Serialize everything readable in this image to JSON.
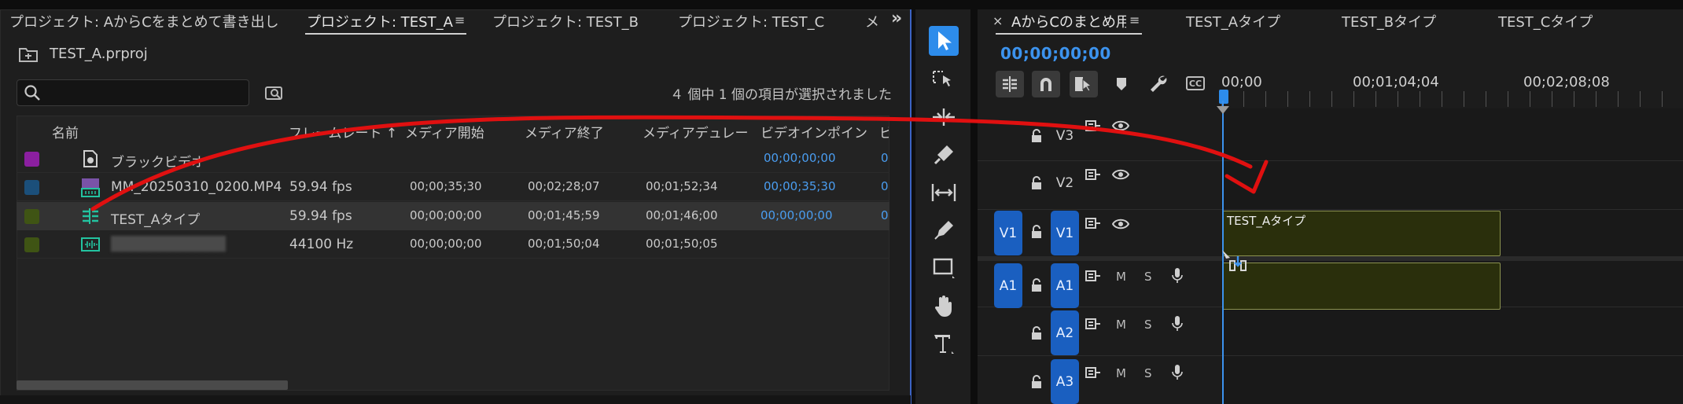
{
  "project_panel": {
    "tabs": [
      {
        "label": "プロジェクト: AからCをまとめて書き出し"
      },
      {
        "label": "プロジェクト: TEST_A"
      },
      {
        "label": "プロジェクト: TEST_B"
      },
      {
        "label": "プロジェクト: TEST_C"
      },
      {
        "label": "メ"
      }
    ],
    "overflow_label": "»",
    "menu_label": "≡",
    "file_name": "TEST_A.prproj",
    "search": {
      "value": "",
      "placeholder": ""
    },
    "selection_status": "４ 個中 1 個の項目が選択されました",
    "columns": [
      "名前",
      "フレームレート ↑",
      "メディア開始",
      "メディア終了",
      "メディアデュレー",
      "ビデオインポイン",
      "ビ"
    ],
    "rows": [
      {
        "swatch": "#8b1fa0",
        "icon": "black-video-icon",
        "name": "ブラックビデオ",
        "fps": "",
        "start": "",
        "end": "",
        "duration": "",
        "in_point": "00;00;00;00",
        "extra": "0"
      },
      {
        "swatch": "#1b4f7a",
        "icon": "video-clip-icon",
        "name": "MM_20250310_0200.MP4",
        "fps": "59.94 fps",
        "start": "00;00;35;30",
        "end": "00;02;28;07",
        "duration": "00;01;52;34",
        "in_point": "00;00;35;30",
        "extra": "0"
      },
      {
        "swatch": "#3f5414",
        "icon": "sequence-icon",
        "name": "TEST_Aタイプ",
        "fps": "59.94 fps",
        "start": "00;00;00;00",
        "end": "00;01;45;59",
        "duration": "00;01;46;00",
        "in_point": "00;00;00;00",
        "extra": "0"
      },
      {
        "swatch": "#3f5414",
        "icon": "audio-clip-icon",
        "name": "████████████",
        "fps": "44100 Hz",
        "start": "00;00;00;00",
        "end": "00;01;50;04",
        "duration": "00;01;50;05",
        "in_point": "",
        "extra": ""
      }
    ]
  },
  "timeline_panel": {
    "close_label": "×",
    "menu_label": "≡",
    "tabs": [
      {
        "label": "AからCのまとめ用"
      },
      {
        "label": "TEST_Aタイプ"
      },
      {
        "label": "TEST_Bタイプ"
      },
      {
        "label": "TEST_Cタイプ"
      }
    ],
    "timecode": "00;00;00;00",
    "ruler": [
      "00;00",
      "00;01;04;04",
      "00;02;08;08"
    ],
    "video_tracks": [
      {
        "name": "V3",
        "source": ""
      },
      {
        "name": "V2",
        "source": ""
      },
      {
        "name": "V1",
        "source": "V1"
      }
    ],
    "audio_tracks": [
      {
        "name": "A1",
        "source": "A1",
        "mute": "M",
        "solo": "S"
      },
      {
        "name": "A2",
        "source": "",
        "mute": "M",
        "solo": "S"
      },
      {
        "name": "A3",
        "source": "",
        "mute": "M",
        "solo": "S"
      }
    ],
    "clip_label": "TEST_Aタイプ",
    "clip_color": "#2a2f0c",
    "clip_border": "#8c9350"
  },
  "tools": [
    "selection-tool",
    "track-select-tool",
    "ripple-edit-tool",
    "razor-tool",
    "slip-tool",
    "pen-tool",
    "rectangle-tool",
    "hand-tool",
    "type-tool"
  ],
  "colors": {
    "accent": "#2d8ceb",
    "annotation_arrow": "#e01010",
    "track_target": "#1a5fc0"
  }
}
